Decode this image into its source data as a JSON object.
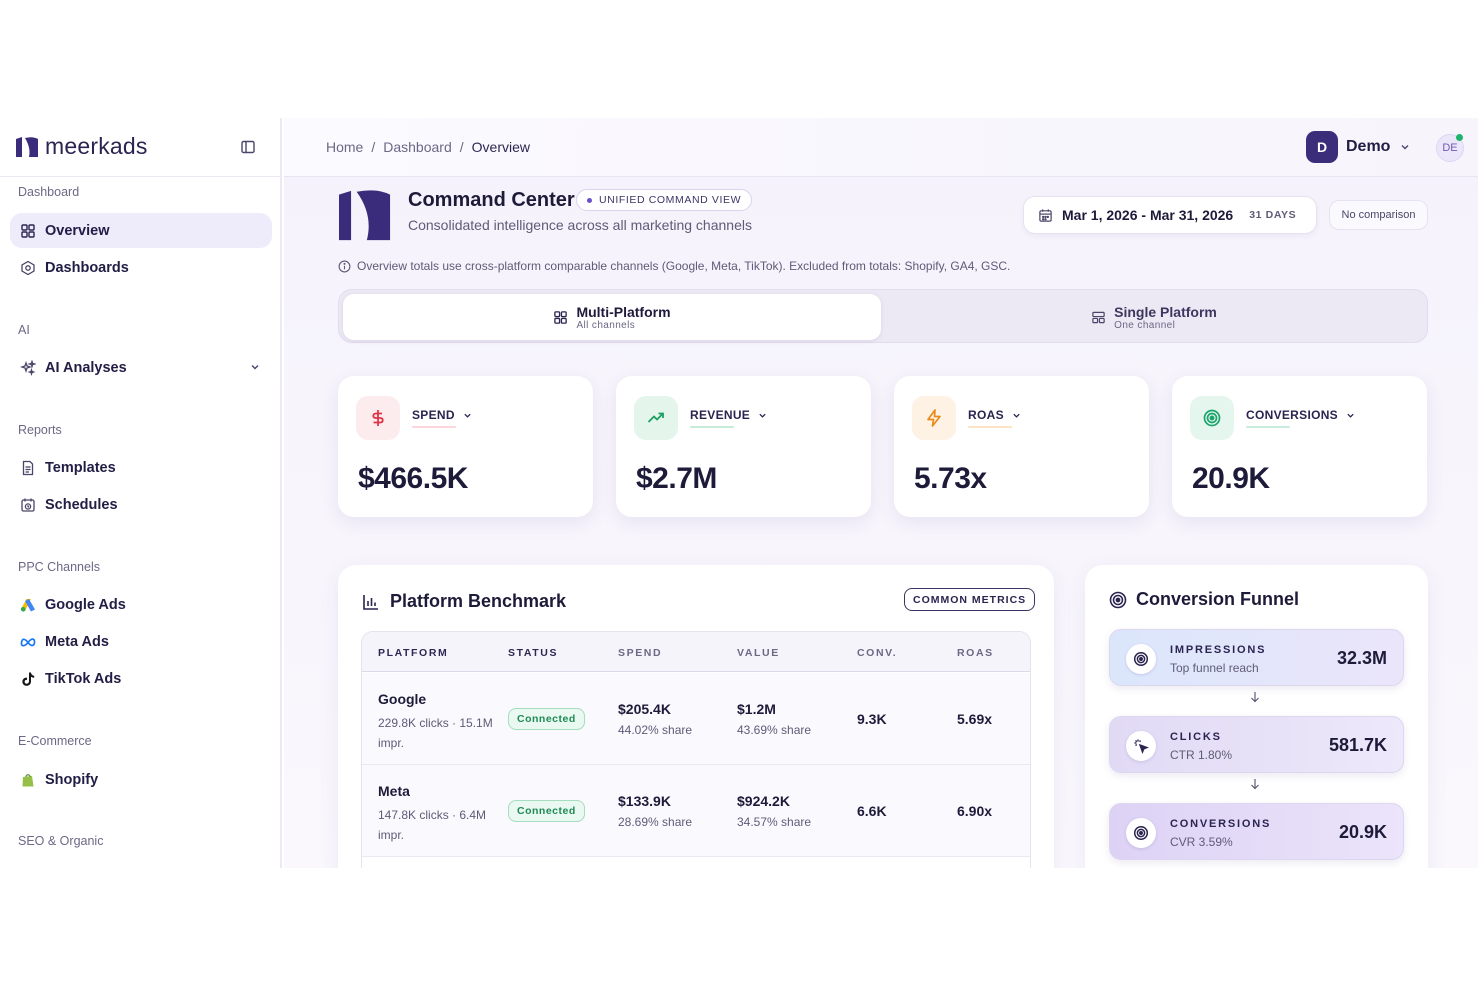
{
  "brand": {
    "name": "meerkads"
  },
  "sidebar": {
    "sections": [
      {
        "title": "Dashboard",
        "items": [
          {
            "label": "Overview",
            "icon": "grid-icon",
            "active": true
          },
          {
            "label": "Dashboards",
            "icon": "hexagon-icon"
          }
        ]
      },
      {
        "title": "AI",
        "items": [
          {
            "label": "AI Analyses",
            "icon": "sparkles-icon"
          }
        ]
      },
      {
        "title": "Reports",
        "items": [
          {
            "label": "Templates",
            "icon": "document-icon"
          },
          {
            "label": "Schedules",
            "icon": "calendar-clock-icon"
          }
        ]
      },
      {
        "title": "PPC Channels",
        "items": [
          {
            "label": "Google Ads",
            "icon": "google-ads-icon"
          },
          {
            "label": "Meta Ads",
            "icon": "meta-icon"
          },
          {
            "label": "TikTok Ads",
            "icon": "tiktok-icon"
          }
        ]
      },
      {
        "title": "E-Commerce",
        "items": [
          {
            "label": "Shopify",
            "icon": "shopify-icon"
          }
        ]
      },
      {
        "title": "SEO & Organic",
        "items": []
      }
    ]
  },
  "header": {
    "breadcrumb": [
      "Home",
      "Dashboard",
      "Overview"
    ],
    "separator": "/",
    "workspace": {
      "initial": "D",
      "name": "Demo"
    },
    "user_initials": "DE"
  },
  "command_center": {
    "title": "Command Center",
    "badge": "UNIFIED COMMAND VIEW",
    "subtitle": "Consolidated intelligence across all marketing channels",
    "date_range": "Mar 1, 2026 - Mar 31, 2026",
    "days": "31 DAYS",
    "comparison": "No comparison",
    "note": "Overview totals use cross-platform comparable channels (Google, Meta, TikTok). Excluded from totals: Shopify, GA4, GSC."
  },
  "view_toggle": {
    "multi": {
      "label": "Multi-Platform",
      "sub": "All channels"
    },
    "single": {
      "label": "Single Platform",
      "sub": "One channel"
    }
  },
  "kpis": [
    {
      "label": "SPEND",
      "value": "$466.5K",
      "color": "#e0334a",
      "bg": "#fdecee"
    },
    {
      "label": "REVENUE",
      "value": "$2.7M",
      "color": "#1d9f62",
      "bg": "#e4f6ec"
    },
    {
      "label": "ROAS",
      "value": "5.73x",
      "color": "#e98a1c",
      "bg": "#fdf2e3"
    },
    {
      "label": "CONVERSIONS",
      "value": "20.9K",
      "color": "#1aa36b",
      "bg": "#e5f6ee"
    }
  ],
  "benchmark": {
    "title": "Platform Benchmark",
    "badge": "COMMON METRICS",
    "columns": [
      "PLATFORM",
      "STATUS",
      "SPEND",
      "VALUE",
      "CONV.",
      "ROAS"
    ],
    "rows": [
      {
        "platform": "Google",
        "detail": "229.8K clicks · 15.1M impr.",
        "status": "Connected",
        "spend": "$205.4K",
        "spend_share": "44.02% share",
        "value": "$1.2M",
        "value_share": "43.69% share",
        "conv": "9.3K",
        "roas": "5.69x"
      },
      {
        "platform": "Meta",
        "detail": "147.8K clicks · 6.4M impr.",
        "status": "Connected",
        "spend": "$133.9K",
        "spend_share": "28.69% share",
        "value": "$924.2K",
        "value_share": "34.57% share",
        "conv": "6.6K",
        "roas": "6.90x"
      }
    ]
  },
  "funnel": {
    "title": "Conversion Funnel",
    "stages": [
      {
        "name": "IMPRESSIONS",
        "sub": "Top funnel reach",
        "value": "32.3M",
        "icon": "target-icon"
      },
      {
        "name": "CLICKS",
        "sub": "CTR 1.80%",
        "value": "581.7K",
        "icon": "cursor-click-icon"
      },
      {
        "name": "CONVERSIONS",
        "sub": "CVR 3.59%",
        "value": "20.9K",
        "icon": "target-icon"
      }
    ]
  }
}
